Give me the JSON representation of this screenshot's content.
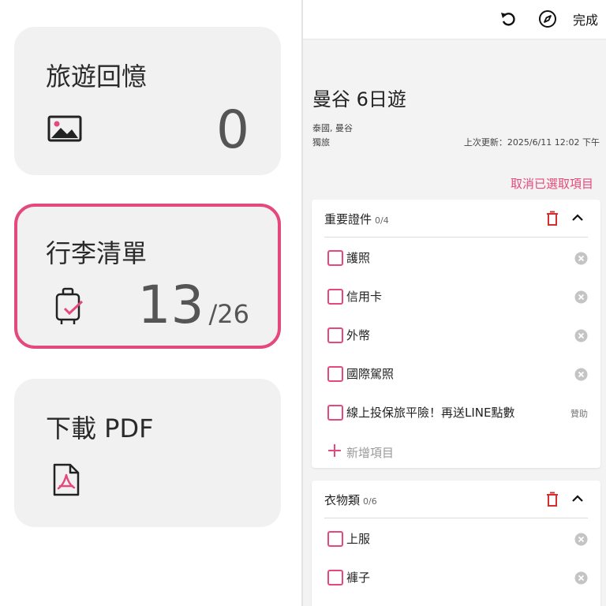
{
  "left_cards": {
    "memories": {
      "title": "旅遊回憶",
      "count": "0",
      "icon": "image-icon"
    },
    "packing": {
      "title": "行李清單",
      "checked": "13",
      "total": "/26",
      "icon": "luggage-check-icon"
    },
    "pdf": {
      "title": "下載 PDF",
      "icon": "pdf-file-icon"
    }
  },
  "topbar": {
    "done_label": "完成",
    "icons": [
      "undo-icon",
      "compass-icon"
    ]
  },
  "trip": {
    "title": "曼谷 6日遊",
    "location": "泰國, 曼谷",
    "style": "獨旅",
    "updated": "上次更新：2025/6/11 12:02 下午",
    "deselect_label": "取消已選取項目"
  },
  "sections": [
    {
      "name": "重要證件",
      "count": "0/4",
      "items": [
        {
          "label": "護照"
        },
        {
          "label": "信用卡"
        },
        {
          "label": "外幣"
        },
        {
          "label": "國際駕照"
        },
        {
          "label": "線上投保旅平險！再送LINE點數",
          "sponsor": "贊助"
        }
      ],
      "add_label": "新增項目"
    },
    {
      "name": "衣物類",
      "count": "0/6",
      "items": [
        {
          "label": "上服"
        },
        {
          "label": "褲子"
        }
      ]
    }
  ],
  "colors": {
    "accent": "#e34a7b",
    "trash": "#d32f2f",
    "card_bg": "#f1f1f1",
    "panel_bg": "#f3f3f3"
  }
}
